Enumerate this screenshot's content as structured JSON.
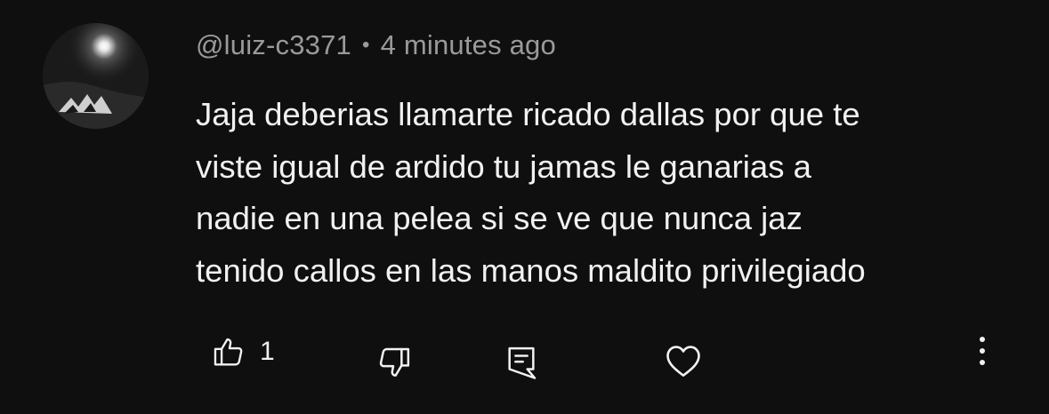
{
  "comment": {
    "author": "@luiz-c3371",
    "separator": "•",
    "timestamp": "4 minutes ago",
    "text_lines": [
      "Jaja deberias llamarte ricado dallas por que te",
      "viste igual de ardido tu jamas le ganarias a",
      "nadie en una pelea si se ve que nunca jaz",
      "tenido callos en las manos maldito privilegiado"
    ]
  },
  "actions": {
    "like_count": "1",
    "icons": [
      "thumbs-up-icon",
      "thumbs-down-icon",
      "reply-icon",
      "heart-icon",
      "more-vertical-icon"
    ]
  },
  "colors": {
    "background": "#0f0f0f",
    "text_primary": "#f1f1f1",
    "text_secondary": "#9a9a9a"
  }
}
